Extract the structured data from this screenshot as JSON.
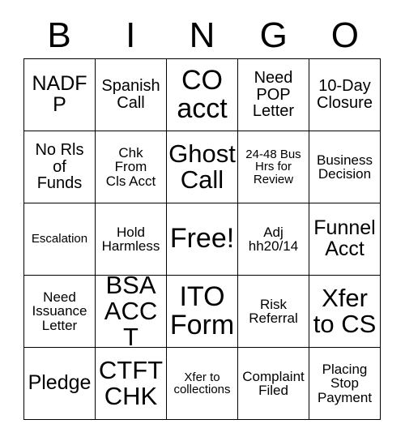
{
  "card": {
    "header_letters": [
      "B",
      "I",
      "N",
      "G",
      "O"
    ],
    "rows": [
      [
        {
          "text": "NADFP",
          "size": "fs-l"
        },
        {
          "text": "Spanish\nCall",
          "size": "fs-m"
        },
        {
          "text": "CO\nacct",
          "size": "fs-xxl"
        },
        {
          "text": "Need\nPOP\nLetter",
          "size": "fs-m"
        },
        {
          "text": "10-Day\nClosure",
          "size": "fs-m"
        }
      ],
      [
        {
          "text": "No Rls\nof\nFunds",
          "size": "fs-m"
        },
        {
          "text": "Chk\nFrom\nCls Acct",
          "size": "fs-s"
        },
        {
          "text": "Ghost\nCall",
          "size": "fs-xl"
        },
        {
          "text": "24-48 Bus\nHrs for\nReview",
          "size": "fs-xs"
        },
        {
          "text": "Business\nDecision",
          "size": "fs-s"
        }
      ],
      [
        {
          "text": "Escalation",
          "size": "fs-xs"
        },
        {
          "text": "Hold\nHarmless",
          "size": "fs-s"
        },
        {
          "text": "Free!",
          "size": "fs-xxl"
        },
        {
          "text": "Adj\nhh20/14",
          "size": "fs-s"
        },
        {
          "text": "Funnel\nAcct",
          "size": "fs-l"
        }
      ],
      [
        {
          "text": "Need\nIssuance\nLetter",
          "size": "fs-s"
        },
        {
          "text": "BSA\nACCT",
          "size": "fs-xl"
        },
        {
          "text": "ITO\nForm",
          "size": "fs-xxl"
        },
        {
          "text": "Risk\nReferral",
          "size": "fs-s"
        },
        {
          "text": "Xfer\nto CS",
          "size": "fs-xl"
        }
      ],
      [
        {
          "text": "Pledge",
          "size": "fs-l"
        },
        {
          "text": "CTFT\nCHK",
          "size": "fs-xl"
        },
        {
          "text": "Xfer to\ncollections",
          "size": "fs-xs"
        },
        {
          "text": "Complaint\nFiled",
          "size": "fs-s"
        },
        {
          "text": "Placing\nStop\nPayment",
          "size": "fs-s"
        }
      ]
    ]
  }
}
